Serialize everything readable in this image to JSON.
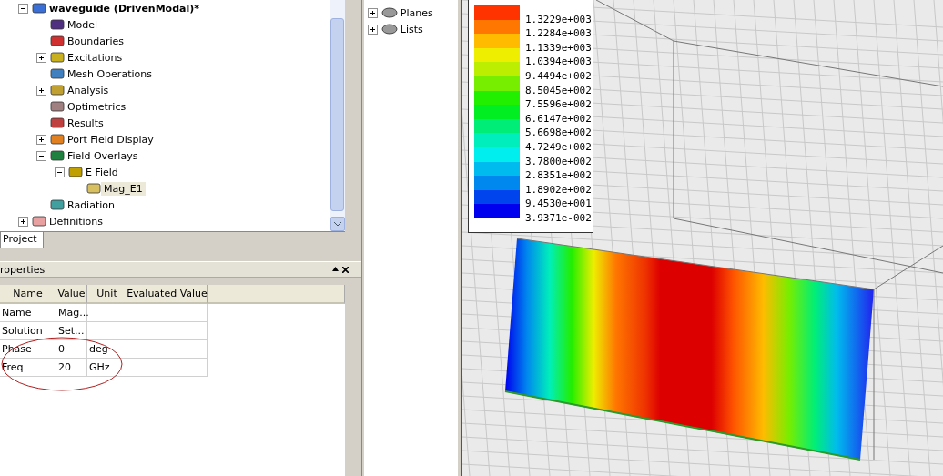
{
  "project_tree": {
    "items": [
      {
        "label": "waveguide (DrivenModal)*",
        "expanded": true,
        "selected": false,
        "children": [
          {
            "label": "Model",
            "selected": false
          },
          {
            "label": "Boundaries",
            "selected": false
          },
          {
            "label": "Excitations",
            "expanded": false,
            "selected": false
          },
          {
            "label": "Mesh Operations",
            "selected": false
          },
          {
            "label": "Analysis",
            "expanded": false,
            "selected": false
          },
          {
            "label": "Optimetrics",
            "selected": false
          },
          {
            "label": "Results",
            "selected": false
          },
          {
            "label": "Port Field Display",
            "expanded": false,
            "selected": false
          },
          {
            "label": "Field Overlays",
            "expanded": true,
            "selected": false,
            "children": [
              {
                "label": "E Field",
                "expanded": true,
                "selected": false,
                "children": [
                  {
                    "label": "Mag_E1",
                    "selected": true
                  }
                ]
              }
            ]
          },
          {
            "label": "Radiation",
            "selected": false
          }
        ]
      },
      {
        "label": "Definitions",
        "expanded": false,
        "selected": false
      }
    ]
  },
  "project_tab": {
    "label": "Project",
    "selected": true
  },
  "properties": {
    "title": "roperties",
    "columns": [
      "Name",
      "Value",
      "Unit",
      "Evaluated Value"
    ],
    "rows": [
      {
        "name": "Name",
        "value": "Mag..."
      },
      {
        "name": "Solution",
        "value": "Set..."
      },
      {
        "name": "Phase",
        "value": "0",
        "unit": "deg"
      },
      {
        "name": "Freq",
        "value": "20",
        "unit": "GHz"
      }
    ]
  },
  "model_tree": {
    "items": [
      {
        "label": "Planes",
        "expanded": false
      },
      {
        "label": "Lists",
        "expanded": false
      }
    ]
  },
  "legend": [
    {
      "label": "1.3229e+003",
      "color": "#ff3300"
    },
    {
      "label": "1.2284e+003",
      "color": "#ff7700"
    },
    {
      "label": "1.1339e+003",
      "color": "#ffbb00"
    },
    {
      "label": "1.0394e+003",
      "color": "#eeee00"
    },
    {
      "label": "9.4494e+002",
      "color": "#bbee00"
    },
    {
      "label": "8.5045e+002",
      "color": "#77ee00"
    },
    {
      "label": "7.5596e+002",
      "color": "#22ee00"
    },
    {
      "label": "6.6147e+002",
      "color": "#00ee22"
    },
    {
      "label": "5.6698e+002",
      "color": "#00ee77"
    },
    {
      "label": "4.7249e+002",
      "color": "#00eebb"
    },
    {
      "label": "3.7800e+002",
      "color": "#00eeee"
    },
    {
      "label": "2.8351e+002",
      "color": "#00bbee"
    },
    {
      "label": "1.8902e+002",
      "color": "#0088ee"
    },
    {
      "label": "9.4530e+001",
      "color": "#0044ee"
    },
    {
      "label": "3.9371e-002",
      "color": "#0000ee"
    }
  ]
}
